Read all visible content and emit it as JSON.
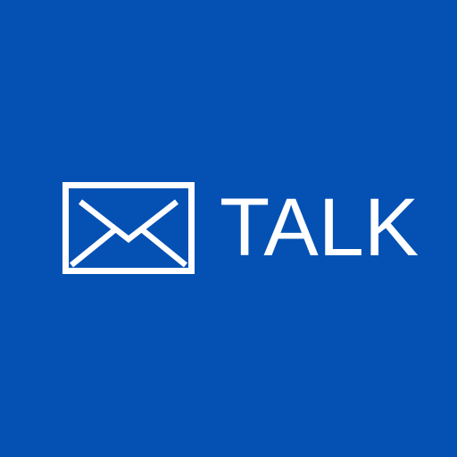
{
  "brand": {
    "name": "TALK",
    "icon": "envelope-icon",
    "background_color": "#0451b3",
    "foreground_color": "#ffffff"
  }
}
